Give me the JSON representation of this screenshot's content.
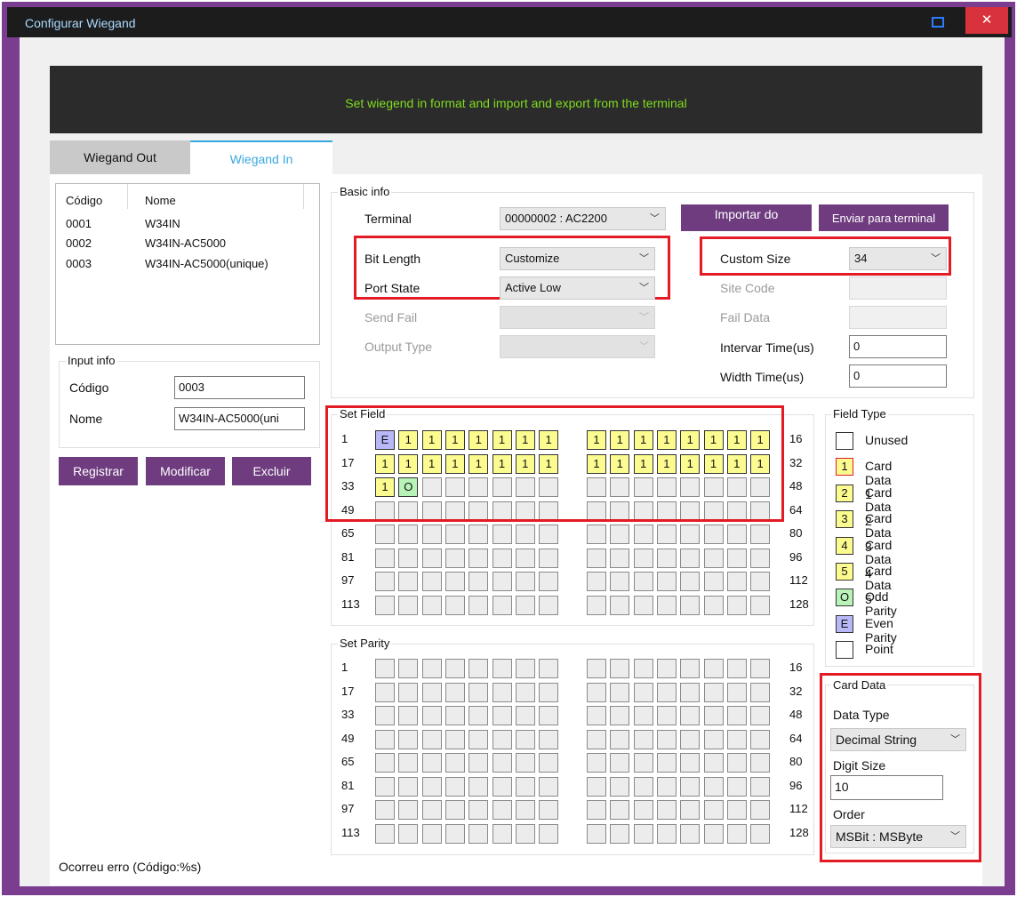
{
  "window": {
    "title": "Configurar Wiegand",
    "minimize_glyph": "",
    "close_glyph": "✕"
  },
  "banner": {
    "text": "Set wiegend in format and import and export from the terminal"
  },
  "tabs": [
    {
      "label": "Wiegand Out",
      "selected": false
    },
    {
      "label": "Wiegand In",
      "selected": true
    }
  ],
  "format_list": {
    "headers": {
      "code": "Código",
      "name": "Nome"
    },
    "rows": [
      {
        "code": "0001",
        "name": "W34IN"
      },
      {
        "code": "0002",
        "name": "W34IN-AC5000"
      },
      {
        "code": "0003",
        "name": "W34IN-AC5000(unique)"
      }
    ]
  },
  "input_info": {
    "title": "Input info",
    "code_label": "Código",
    "code_value": "0003",
    "name_label": "Nome",
    "name_value": "W34IN-AC5000(uni"
  },
  "actions": {
    "register": "Registrar",
    "modify": "Modificar",
    "delete": "Excluir"
  },
  "basic_info": {
    "title": "Basic info",
    "terminal_label": "Terminal",
    "terminal_value": "00000002 : AC2200",
    "import_button": "Importar do",
    "send_button": "Enviar para terminal",
    "bit_length_label": "Bit Length",
    "bit_length_value": "Customize",
    "port_state_label": "Port State",
    "port_state_value": "Active Low",
    "send_fail_label": "Send Fail",
    "output_type_label": "Output Type",
    "custom_size_label": "Custom Size",
    "custom_size_value": "34",
    "site_code_label": "Site Code",
    "fail_data_label": "Fail Data",
    "interval_label": "Intervar Time(us)",
    "interval_value": "0",
    "width_label": "Width Time(us)",
    "width_value": "0"
  },
  "set_field": {
    "title": "Set Field",
    "rows": [
      {
        "start": "1",
        "end": "16",
        "cells": [
          "E",
          "1",
          "1",
          "1",
          "1",
          "1",
          "1",
          "1",
          "1",
          "1",
          "1",
          "1",
          "1",
          "1",
          "1",
          "1"
        ]
      },
      {
        "start": "17",
        "end": "32",
        "cells": [
          "1",
          "1",
          "1",
          "1",
          "1",
          "1",
          "1",
          "1",
          "1",
          "1",
          "1",
          "1",
          "1",
          "1",
          "1",
          "1"
        ]
      },
      {
        "start": "33",
        "end": "48",
        "cells": [
          "1",
          "O",
          "",
          "",
          "",
          "",
          "",
          "",
          "",
          "",
          "",
          "",
          "",
          "",
          "",
          ""
        ]
      },
      {
        "start": "49",
        "end": "64",
        "cells": [
          "",
          "",
          "",
          "",
          "",
          "",
          "",
          "",
          "",
          "",
          "",
          "",
          "",
          "",
          "",
          ""
        ]
      },
      {
        "start": "65",
        "end": "80",
        "cells": [
          "",
          "",
          "",
          "",
          "",
          "",
          "",
          "",
          "",
          "",
          "",
          "",
          "",
          "",
          "",
          ""
        ]
      },
      {
        "start": "81",
        "end": "96",
        "cells": [
          "",
          "",
          "",
          "",
          "",
          "",
          "",
          "",
          "",
          "",
          "",
          "",
          "",
          "",
          "",
          ""
        ]
      },
      {
        "start": "97",
        "end": "112",
        "cells": [
          "",
          "",
          "",
          "",
          "",
          "",
          "",
          "",
          "",
          "",
          "",
          "",
          "",
          "",
          "",
          ""
        ]
      },
      {
        "start": "113",
        "end": "128",
        "cells": [
          "",
          "",
          "",
          "",
          "",
          "",
          "",
          "",
          "",
          "",
          "",
          "",
          "",
          "",
          "",
          ""
        ]
      }
    ]
  },
  "set_parity": {
    "title": "Set Parity",
    "rows": [
      {
        "start": "1",
        "end": "16"
      },
      {
        "start": "17",
        "end": "32"
      },
      {
        "start": "33",
        "end": "48"
      },
      {
        "start": "49",
        "end": "64"
      },
      {
        "start": "65",
        "end": "80"
      },
      {
        "start": "81",
        "end": "96"
      },
      {
        "start": "97",
        "end": "112"
      },
      {
        "start": "113",
        "end": "128"
      }
    ]
  },
  "field_type": {
    "title": "Field Type",
    "items": [
      {
        "glyph": "",
        "label": "Unused",
        "color": "#ffffff",
        "border": "#333333"
      },
      {
        "glyph": "1",
        "label": "Card Data 1",
        "color": "#fbfb90",
        "border": "#e21b24"
      },
      {
        "glyph": "2",
        "label": "Card Data 2",
        "color": "#fbfb90",
        "border": "#333333"
      },
      {
        "glyph": "3",
        "label": "Card Data 3",
        "color": "#fbfb90",
        "border": "#333333"
      },
      {
        "glyph": "4",
        "label": "Card Data 4",
        "color": "#fbfb90",
        "border": "#333333"
      },
      {
        "glyph": "5",
        "label": "Card Data 5",
        "color": "#fbfb90",
        "border": "#333333"
      },
      {
        "glyph": "O",
        "label": "Odd Parity",
        "color": "#b8f4b8",
        "border": "#333333"
      },
      {
        "glyph": "E",
        "label": "Even Parity",
        "color": "#b8b8f8",
        "border": "#333333"
      },
      {
        "glyph": "",
        "label": "Point",
        "color": "#ffffff",
        "border": "#333333"
      }
    ]
  },
  "card_data": {
    "title": "Card Data",
    "data_type_label": "Data Type",
    "data_type_value": "Decimal String",
    "digit_size_label": "Digit Size",
    "digit_size_value": "10",
    "order_label": "Order",
    "order_value": "MSBit : MSByte"
  },
  "status": {
    "text": "Ocorreu erro (Código:%s)"
  },
  "colors": {
    "accent_purple": "#6e3c7f",
    "highlight_red": "#e21b24",
    "banner_text": "#7fdc1f",
    "tab_active": "#39a8e0"
  }
}
